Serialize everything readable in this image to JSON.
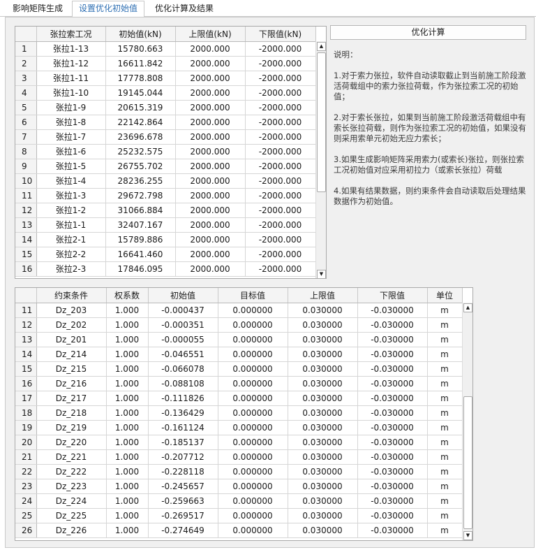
{
  "tabs": [
    {
      "label": "影响矩阵生成",
      "active": false
    },
    {
      "label": "设置优化初始值",
      "active": true
    },
    {
      "label": "优化计算及结果",
      "active": false
    }
  ],
  "tension_table": {
    "columns": [
      "张拉索工况",
      "初始值(kN)",
      "上限值(kN)",
      "下限值(kN)"
    ],
    "rows": [
      {
        "n": "1",
        "c": [
          "张拉1-13",
          "15780.663",
          "2000.000",
          "-2000.000"
        ]
      },
      {
        "n": "2",
        "c": [
          "张拉1-12",
          "16611.842",
          "2000.000",
          "-2000.000"
        ]
      },
      {
        "n": "3",
        "c": [
          "张拉1-11",
          "17778.808",
          "2000.000",
          "-2000.000"
        ]
      },
      {
        "n": "4",
        "c": [
          "张拉1-10",
          "19145.044",
          "2000.000",
          "-2000.000"
        ]
      },
      {
        "n": "5",
        "c": [
          "张拉1-9",
          "20615.319",
          "2000.000",
          "-2000.000"
        ]
      },
      {
        "n": "6",
        "c": [
          "张拉1-8",
          "22142.864",
          "2000.000",
          "-2000.000"
        ]
      },
      {
        "n": "7",
        "c": [
          "张拉1-7",
          "23696.678",
          "2000.000",
          "-2000.000"
        ]
      },
      {
        "n": "8",
        "c": [
          "张拉1-6",
          "25232.575",
          "2000.000",
          "-2000.000"
        ]
      },
      {
        "n": "9",
        "c": [
          "张拉1-5",
          "26755.702",
          "2000.000",
          "-2000.000"
        ]
      },
      {
        "n": "10",
        "c": [
          "张拉1-4",
          "28236.255",
          "2000.000",
          "-2000.000"
        ]
      },
      {
        "n": "11",
        "c": [
          "张拉1-3",
          "29672.798",
          "2000.000",
          "-2000.000"
        ]
      },
      {
        "n": "12",
        "c": [
          "张拉1-2",
          "31066.884",
          "2000.000",
          "-2000.000"
        ]
      },
      {
        "n": "13",
        "c": [
          "张拉1-1",
          "32407.167",
          "2000.000",
          "-2000.000"
        ]
      },
      {
        "n": "14",
        "c": [
          "张拉2-1",
          "15789.886",
          "2000.000",
          "-2000.000"
        ]
      },
      {
        "n": "15",
        "c": [
          "张拉2-2",
          "16641.460",
          "2000.000",
          "-2000.000"
        ]
      },
      {
        "n": "16",
        "c": [
          "张拉2-3",
          "17846.095",
          "2000.000",
          "-2000.000"
        ]
      }
    ]
  },
  "calc_button": "优化计算",
  "notes": [
    "说明：",
    "1.对于索力张拉，软件自动读取截止到当前施工阶段激活荷载组中的索力张拉荷载，作为张拉索工况的初始值；",
    "2.对于索长张拉，如果到当前施工阶段激活荷载组中有索长张拉荷载，则作为张拉索工况的初始值，如果没有则采用索单元初始无应力索长；",
    "3.如果生成影响矩阵采用索力(或索长)张拉，则张拉索工况初始值对应采用初拉力（或索长张拉）荷载",
    "4.如果有结果数据，则约束条件会自动读取后处理结果数据作为初始值。"
  ],
  "constraint_table": {
    "columns": [
      "约束条件",
      "权系数",
      "初始值",
      "目标值",
      "上限值",
      "下限值",
      "单位"
    ],
    "rows": [
      {
        "n": "11",
        "c": [
          "Dz_203",
          "1.000",
          "-0.000437",
          "0.000000",
          "0.030000",
          "-0.030000",
          "m"
        ]
      },
      {
        "n": "12",
        "c": [
          "Dz_202",
          "1.000",
          "-0.000351",
          "0.000000",
          "0.030000",
          "-0.030000",
          "m"
        ]
      },
      {
        "n": "13",
        "c": [
          "Dz_201",
          "1.000",
          "-0.000055",
          "0.000000",
          "0.030000",
          "-0.030000",
          "m"
        ]
      },
      {
        "n": "14",
        "c": [
          "Dz_214",
          "1.000",
          "-0.046551",
          "0.000000",
          "0.030000",
          "-0.030000",
          "m"
        ]
      },
      {
        "n": "15",
        "c": [
          "Dz_215",
          "1.000",
          "-0.066078",
          "0.000000",
          "0.030000",
          "-0.030000",
          "m"
        ]
      },
      {
        "n": "16",
        "c": [
          "Dz_216",
          "1.000",
          "-0.088108",
          "0.000000",
          "0.030000",
          "-0.030000",
          "m"
        ]
      },
      {
        "n": "17",
        "c": [
          "Dz_217",
          "1.000",
          "-0.111826",
          "0.000000",
          "0.030000",
          "-0.030000",
          "m"
        ]
      },
      {
        "n": "18",
        "c": [
          "Dz_218",
          "1.000",
          "-0.136429",
          "0.000000",
          "0.030000",
          "-0.030000",
          "m"
        ]
      },
      {
        "n": "19",
        "c": [
          "Dz_219",
          "1.000",
          "-0.161124",
          "0.000000",
          "0.030000",
          "-0.030000",
          "m"
        ]
      },
      {
        "n": "20",
        "c": [
          "Dz_220",
          "1.000",
          "-0.185137",
          "0.000000",
          "0.030000",
          "-0.030000",
          "m"
        ]
      },
      {
        "n": "21",
        "c": [
          "Dz_221",
          "1.000",
          "-0.207712",
          "0.000000",
          "0.030000",
          "-0.030000",
          "m"
        ]
      },
      {
        "n": "22",
        "c": [
          "Dz_222",
          "1.000",
          "-0.228118",
          "0.000000",
          "0.030000",
          "-0.030000",
          "m"
        ]
      },
      {
        "n": "23",
        "c": [
          "Dz_223",
          "1.000",
          "-0.245657",
          "0.000000",
          "0.030000",
          "-0.030000",
          "m"
        ]
      },
      {
        "n": "24",
        "c": [
          "Dz_224",
          "1.000",
          "-0.259663",
          "0.000000",
          "0.030000",
          "-0.030000",
          "m"
        ]
      },
      {
        "n": "25",
        "c": [
          "Dz_225",
          "1.000",
          "-0.269517",
          "0.000000",
          "0.030000",
          "-0.030000",
          "m"
        ]
      },
      {
        "n": "26",
        "c": [
          "Dz_226",
          "1.000",
          "-0.274649",
          "0.000000",
          "0.030000",
          "-0.030000",
          "m"
        ]
      }
    ]
  }
}
